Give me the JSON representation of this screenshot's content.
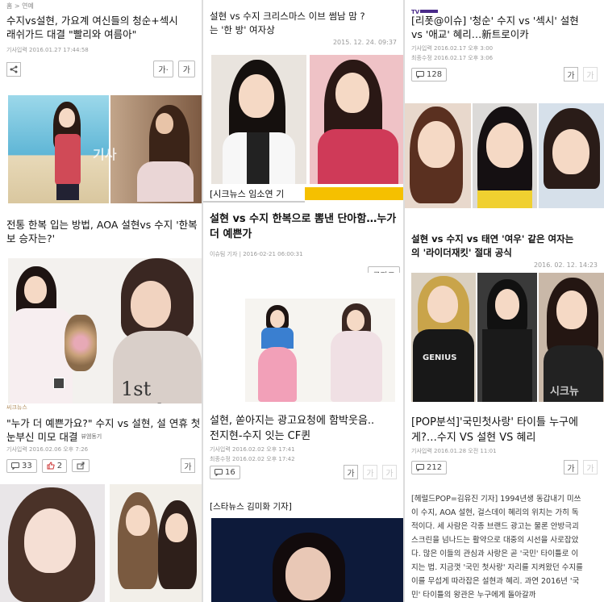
{
  "col1": {
    "a1_breadcrumb": "홈 > 연예",
    "a1_title_l1": "수지vs설현, 가요계 여신들의 청순+섹시",
    "a1_title_l2": "래쉬가드 대결 \"빨리와 여름아\"",
    "a1_meta": "기사입력 2016.01.27 17:44:58",
    "a1_font_btn": "가·",
    "a1_font_btn2": "가",
    "a2_title_l1": "전통 한복 입는 방법, AOA 설현vs 수지 '한복",
    "a2_title_l2": "보 승자는?'",
    "a2_logo_mark": "1st Look",
    "a3_label": "씨크뉴스",
    "a3_title_l1": "\"누가 더 예쁜가요?\" 수지 vs 설현, 설 연휴 첫",
    "a3_title_l2": "눈부신 미모 대결",
    "a3_source": "뷰엠동기",
    "a3_meta": "기사입력 2016.02.06 오후 7:26",
    "a3_comments": "33",
    "a3_likes": "2",
    "a3_font": "가"
  },
  "col2": {
    "b1_title_l1": "설현 vs 수지 크리스마스 이브 썸남 맘 ?",
    "b1_title_l2": "는 '한 방' 여자상",
    "b1_date": "2015. 12. 24. 09:37",
    "b1_caption": "[시크뉴스 임소연 기",
    "b2_title_l1": "설현 vs 수지 한복으로 뽐낸 단아함…누가",
    "b2_title_l2": "더 예쁜가",
    "b2_meta": "이슈팀 기자 | 2016-02-21 06:00:31",
    "b2_btn": "글자크",
    "b3_title_l1": "설현, 쏟아지는 광고요청에 함박웃음..",
    "b3_title_l2": "전지현-수지 잇는 CF퀸",
    "b3_meta1": "기사입력 2016.02.02 오후 17:41",
    "b3_meta2": "최종수정 2016.02.02 오후 17:42",
    "b3_comments": "16",
    "b3_font": "가",
    "b4_caption": "[스타뉴스 김미화 기자]"
  },
  "col3": {
    "c1_title_l1": "[리폿@이슈] '청순' 수지 vs '섹시' 설현",
    "c1_title_l2": "vs '애교' 혜리…新트로이카",
    "c1_meta1": "기사입력 2016.02.17 오후 3:00",
    "c1_meta2": "최종수정 2016.02.17 오후 3:06",
    "c1_comments": "128",
    "c1_font": "가",
    "c2_title_l1": "설현 vs 수지 vs 태연 '여우' 같은 여자는",
    "c2_title_l2": "의 '라이더재킷' 절대 공식",
    "c2_date": "2016. 02. 12. 14:23",
    "c2_watermark": "시크뉴",
    "c2_tshirt": "GENIUS",
    "c3_title_l1": "[POP분석]'국민첫사랑' 타이틀 누구에",
    "c3_title_l2": "게?…수지 VS 설현 VS 혜리",
    "c3_meta": "기사입력 2016.01.28 오전 11:01",
    "c3_comments": "212",
    "c3_font": "가",
    "c4_body": [
      "[헤럴드POP=김유진 기자] 1994년생 동갑내기 미쓰",
      "이 수지, AOA 설현, 걸스데이 혜리의 위치는 가히 독",
      "적이다. 세 사람은 각종 브랜드 광고는 물론 안방극괴",
      "스크린을 넘나드는 활약으로 대중의 시선을 사로잡았",
      "다. 많은 이들의 관심과 사랑은 곧 '국민' 타이틀로 이",
      "지는 법. 지금껏 '국민 첫사랑' 자리를 지켜왔던 수지를",
      "이를 무섭게 따라잡은 설현과 혜리. 과연 2016년 '국",
      "민' 타이틀의 왕관은 누구에게 돌아갈까"
    ]
  },
  "colors": {
    "bg": "#dcdcdc",
    "text": "#111111",
    "meta": "#999999",
    "tv_logo": "#4a2a8a"
  }
}
